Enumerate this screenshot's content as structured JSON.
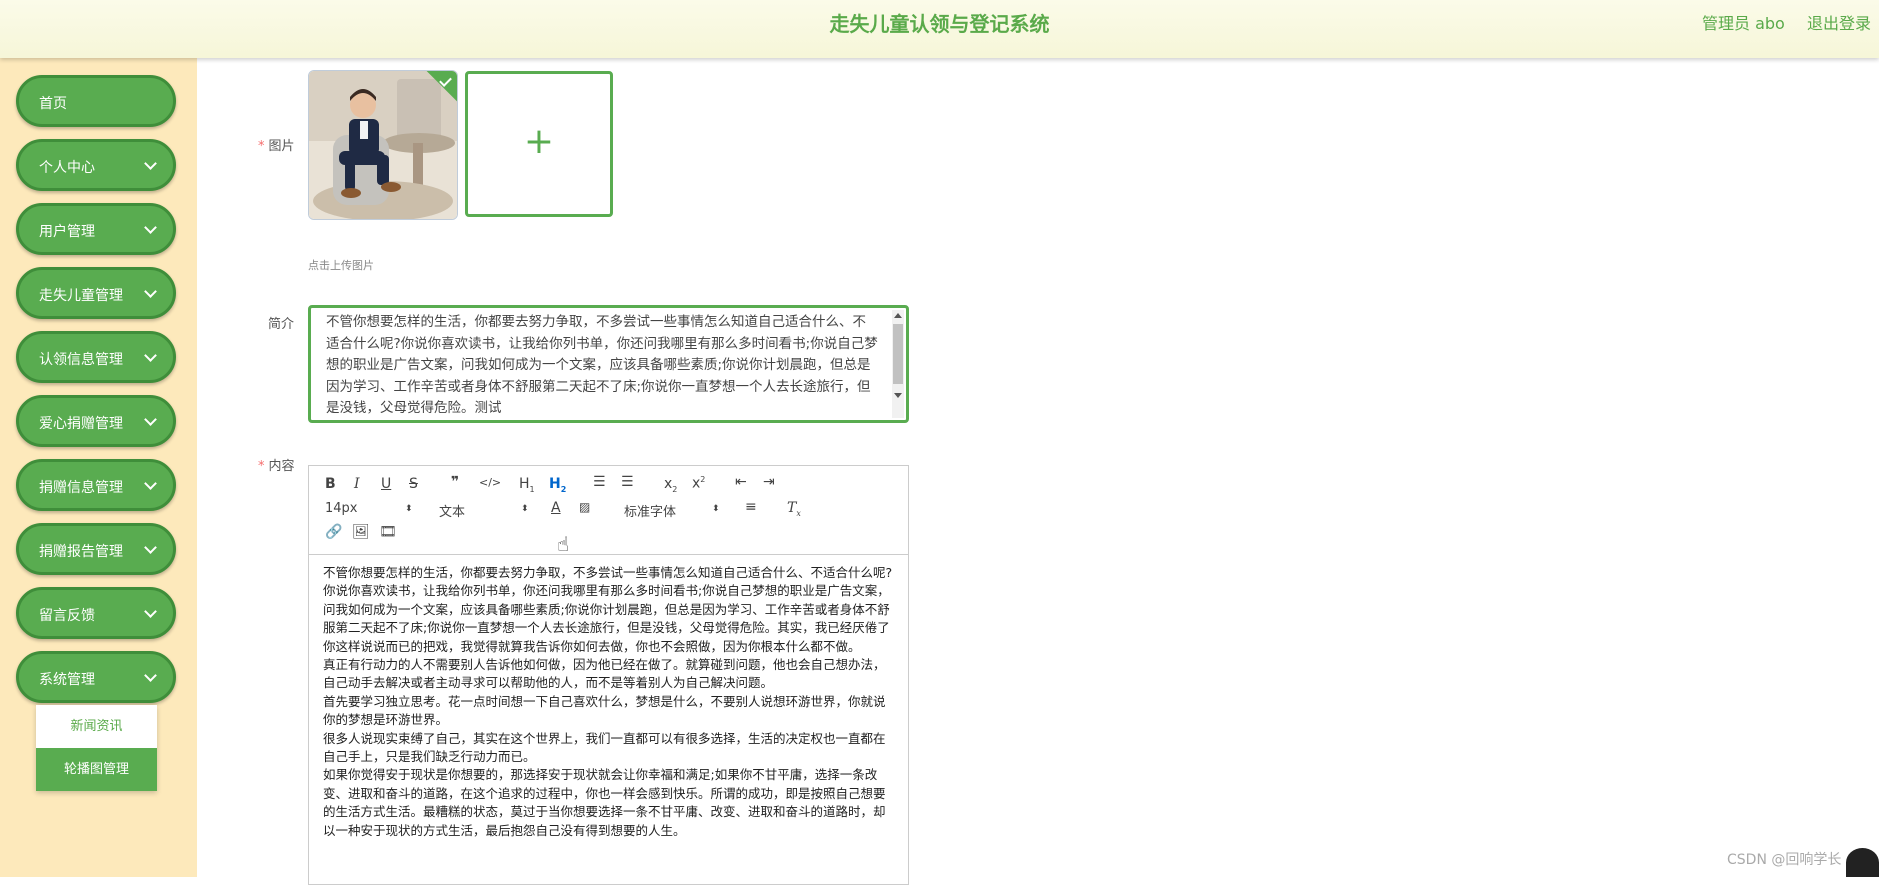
{
  "header": {
    "title": "走失儿童认领与登记系统",
    "admin": "管理员 abo",
    "logout": "退出登录"
  },
  "sidebar": {
    "items": [
      {
        "label": "首页"
      },
      {
        "label": "个人中心"
      },
      {
        "label": "用户管理"
      },
      {
        "label": "走失儿童管理"
      },
      {
        "label": "认领信息管理"
      },
      {
        "label": "爱心捐赠管理"
      },
      {
        "label": "捐赠信息管理"
      },
      {
        "label": "捐赠报告管理"
      },
      {
        "label": "留言反馈"
      },
      {
        "label": "系统管理"
      }
    ],
    "submenu": [
      "新闻资讯",
      "轮播图管理"
    ]
  },
  "form": {
    "image_label": "图片",
    "upload_hint": "点击上传图片",
    "intro_label": "简介",
    "intro_text": "不管你想要怎样的生活，你都要去努力争取，不多尝试一些事情怎么知道自己适合什么、不适合什么呢?你说你喜欢读书，让我给你列书单，你还问我哪里有那么多时间看书;你说自己梦想的职业是广告文案，问我如何成为一个文案，应该具备哪些素质;你说你计划晨跑，但总是因为学习、工作辛苦或者身体不舒服第二天起不了床;你说你一直梦想一个人去长途旅行，但是没钱，父母觉得危险。测试",
    "content_label": "内容"
  },
  "editor": {
    "size_picker": "14px",
    "format_picker": "文本",
    "font_picker": "标准字体",
    "paragraphs": [
      "不管你想要怎样的生活，你都要去努力争取，不多尝试一些事情怎么知道自己适合什么、不适合什么呢?",
      "你说你喜欢读书，让我给你列书单，你还问我哪里有那么多时间看书;你说自己梦想的职业是广告文案，问我如何成为一个文案，应该具备哪些素质;你说你计划晨跑，但总是因为学习、工作辛苦或者身体不舒服第二天起不了床;你说你一直梦想一个人去长途旅行，但是没钱，父母觉得危险。其实，我已经厌倦了你这样说说而已的把戏，我觉得就算我告诉你如何去做，你也不会照做，因为你根本什么都不做。",
      "真正有行动力的人不需要别人告诉他如何做，因为他已经在做了。就算碰到问题，他也会自己想办法，自己动手去解决或者主动寻求可以帮助他的人，而不是等着别人为自己解决问题。",
      "首先要学习独立思考。花一点时间想一下自己喜欢什么，梦想是什么，不要别人说想环游世界，你就说你的梦想是环游世界。",
      "很多人说现实束缚了自己，其实在这个世界上，我们一直都可以有很多选择，生活的决定权也一直都在自己手上，只是我们缺乏行动力而已。",
      "如果你觉得安于现状是你想要的，那选择安于现状就会让你幸福和满足;如果你不甘平庸，选择一条改变、进取和奋斗的道路，在这个追求的过程中，你也一样会感到快乐。所谓的成功，即是按照自己想要的生活方式生活。最糟糕的状态，莫过于当你想要选择一条不甘平庸、改变、进取和奋斗的道路时，却以一种安于现状的方式生活，最后抱怨自己没有得到想要的人生。"
    ]
  },
  "watermark": "CSDN @回响学长"
}
